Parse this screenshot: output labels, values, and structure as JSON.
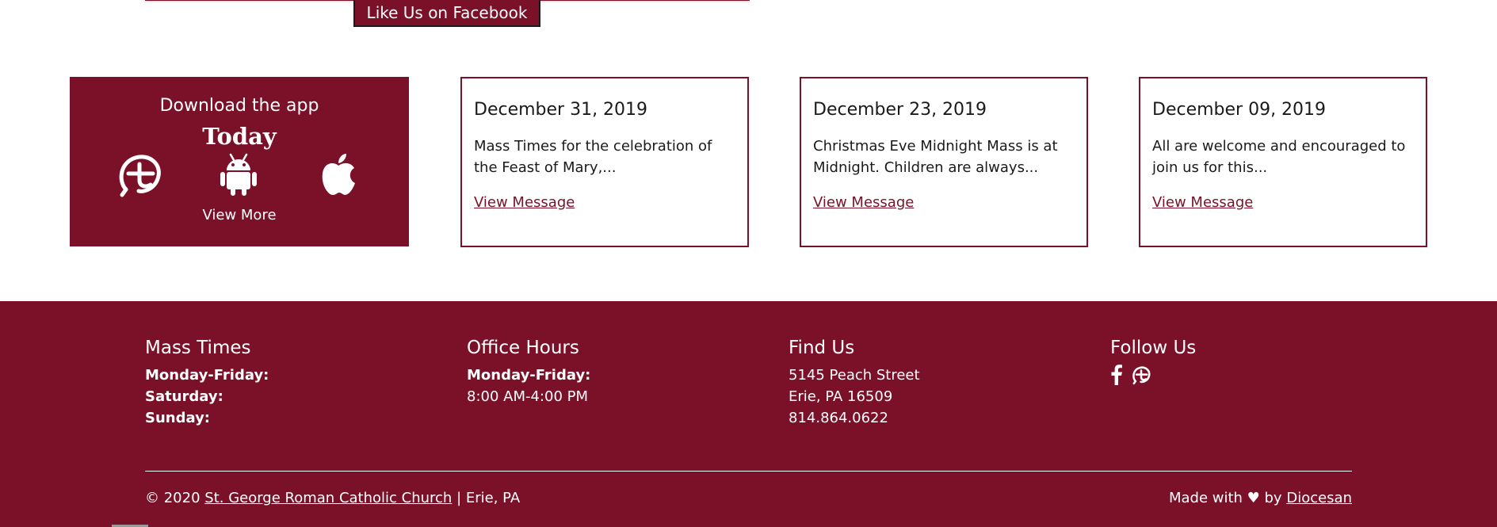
{
  "facebook": {
    "label": "Like Us on Facebook"
  },
  "app_card": {
    "title": "Download the app",
    "subtitle": "Today",
    "more_label": "View More",
    "icons": [
      "tithely-icon",
      "android-icon",
      "apple-icon"
    ]
  },
  "messages": [
    {
      "date": "December 31, 2019",
      "excerpt": "Mass Times for the celebration of the Feast of Mary,...",
      "link": "View Message"
    },
    {
      "date": "December 23, 2019",
      "excerpt": "Christmas Eve Midnight Mass is at Midnight. Children are always...",
      "link": "View Message"
    },
    {
      "date": "December 09, 2019",
      "excerpt": "All are welcome and encouraged to join us for this...",
      "link": "View Message"
    }
  ],
  "footer": {
    "mass": {
      "title": "Mass Times",
      "lines": [
        "Monday-Friday:",
        "Saturday:",
        "Sunday:"
      ]
    },
    "office": {
      "title": "Office Hours",
      "label": "Monday-Friday:",
      "hours": "8:00 AM-4:00 PM"
    },
    "find": {
      "title": "Find Us",
      "street": "5145 Peach Street",
      "city": "Erie, PA 16509",
      "phone": "814.864.0622"
    },
    "follow": {
      "title": "Follow Us",
      "icons": [
        "facebook-icon",
        "tithely-icon"
      ]
    },
    "copyright_prefix": "© 2020",
    "church_name": "St. George Roman Catholic Church",
    "copyright_suffix": "| Erie, PA",
    "made_prefix": "Made with ♥ by",
    "made_link": "Diocesan"
  },
  "colors": {
    "brand": "#7b1128",
    "text": "#1a1a1a",
    "background": "#ffffff"
  }
}
